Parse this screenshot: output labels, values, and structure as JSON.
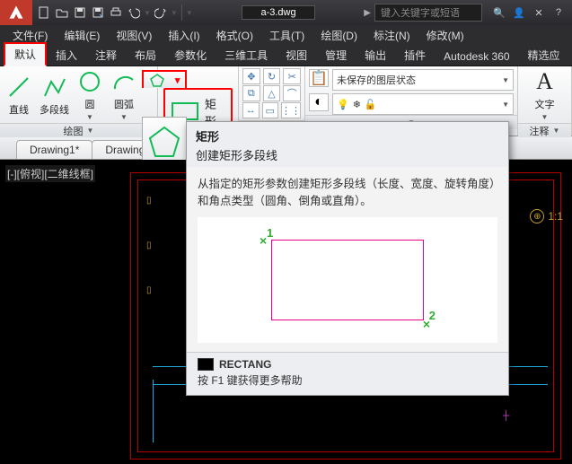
{
  "titlebar": {
    "doc_title": "a-3.dwg",
    "search_placeholder": "键入关键字或短语"
  },
  "menubar": {
    "items": [
      "文件(F)",
      "编辑(E)",
      "视图(V)",
      "插入(I)",
      "格式(O)",
      "工具(T)",
      "绘图(D)",
      "标注(N)",
      "修改(M)"
    ]
  },
  "ribbon_tabs": {
    "items": [
      "默认",
      "插入",
      "注释",
      "布局",
      "参数化",
      "三维工具",
      "视图",
      "管理",
      "输出",
      "插件",
      "Autodesk 360",
      "精选应"
    ]
  },
  "panel_draw": {
    "title": "绘图",
    "tools": {
      "line": "直线",
      "polyline": "多段线",
      "circle": "圆",
      "arc": "圆弧"
    }
  },
  "rectangle_button": {
    "label": "矩形"
  },
  "panel_modify": {
    "title": ""
  },
  "panel_layer": {
    "title": "",
    "state_label": "未保存的图层状态"
  },
  "panel_annot": {
    "title": "注释",
    "text": "文字"
  },
  "doctabs": {
    "items": [
      "Drawing1*",
      "Drawing"
    ]
  },
  "viewport": {
    "view_label": "[-][俯视][二维线框]",
    "scale": "1:1"
  },
  "tooltip": {
    "title": "矩形",
    "subtitle": "创建矩形多段线",
    "body": "从指定的矩形参数创建矩形多段线（长度、宽度、旋转角度）和角点类型（圆角、倒角或直角）。",
    "pt1": "1",
    "pt2": "2",
    "command": "RECTANG",
    "help": "按 F1 键获得更多帮助"
  }
}
